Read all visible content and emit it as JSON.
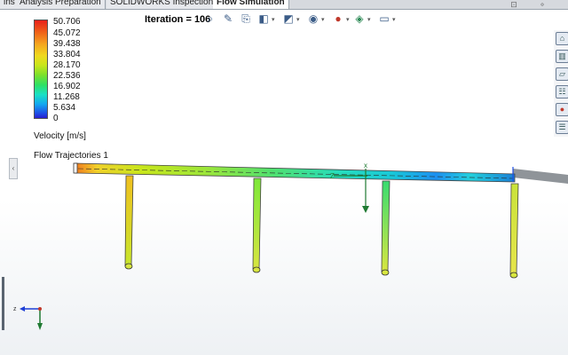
{
  "tabs": [
    {
      "label": "ins",
      "active": false
    },
    {
      "label": "Analysis Preparation",
      "active": false
    },
    {
      "label": "SOLIDWORKS Inspection",
      "active": false
    },
    {
      "label": "Flow Simulation",
      "active": true
    }
  ],
  "legend": {
    "ticks": [
      "50.706",
      "45.072",
      "39.438",
      "33.804",
      "28.170",
      "22.536",
      "16.902",
      "11.268",
      "5.634",
      "0"
    ],
    "title": "Velocity [m/s]"
  },
  "trajectory_label": "Flow Trajectories 1",
  "iteration": {
    "label": "Iteration =",
    "value": "106"
  },
  "toolbar_icons": [
    "zoom-fit-icon",
    "zoom-area-icon",
    "previous-view-icon",
    "section-view-icon",
    "view-orientation-icon",
    "display-style-icon",
    "hide-show-icon",
    "edit-appearance-icon",
    "apply-scene-icon",
    "display-monitor-icon"
  ],
  "right_panel_icons": [
    "home-icon",
    "parts-icon",
    "folder-icon",
    "tree-icon",
    "appearance-icon",
    "properties-icon"
  ],
  "triad": {
    "axes": [
      "z",
      "y"
    ]
  },
  "colors": {
    "tab_active": "#ffffff",
    "pipe_gray": "#8f9499",
    "legend_high": "#e8201a",
    "legend_low": "#2a1fd0"
  }
}
